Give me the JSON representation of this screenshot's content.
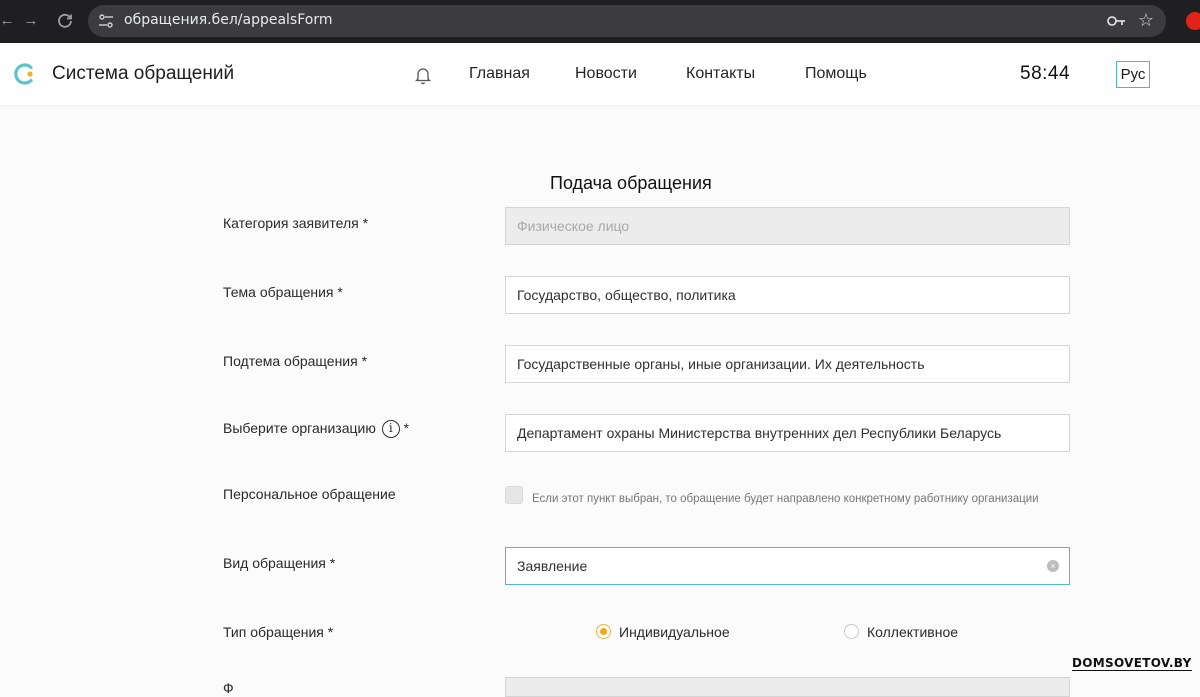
{
  "browser": {
    "url": "обращения.бел/appealsForm",
    "icons": [
      "back-arrow-icon",
      "forward-arrow-icon",
      "reload-icon",
      "site-settings-icon",
      "password-key-icon",
      "bookmark-star-icon",
      "extension-icon"
    ]
  },
  "header": {
    "title": "Система обращений",
    "nav": [
      "Главная",
      "Новости",
      "Контакты",
      "Помощь"
    ],
    "timer": "58:44",
    "language": "Рус"
  },
  "form": {
    "title": "Подача обращения",
    "applicant_category": {
      "label": "Категория заявителя *",
      "placeholder": "Физическое лицо"
    },
    "topic": {
      "label": "Тема обращения *",
      "value": "Государство, общество, политика"
    },
    "subtopic": {
      "label": "Подтема обращения *",
      "value": "Государственные органы, иные организации. Их деятельность"
    },
    "organization": {
      "label": "Выберите организацию",
      "required_mark": "*",
      "info": "i",
      "value": "Департамент охраны Министерства внутренних дел Республики Беларусь"
    },
    "personal": {
      "label": "Персональное обращение",
      "note": "Если этот пункт выбран, то обращение будет направлено конкретному работнику организации",
      "checked": false
    },
    "appeal_kind": {
      "label": "Вид обращения *",
      "value": "Заявление",
      "clear": "×"
    },
    "appeal_type": {
      "label": "Тип обращения *",
      "options": [
        "Индивидуальное",
        "Коллективное"
      ],
      "selected": "Индивидуальное"
    },
    "next_label": "Ф"
  },
  "watermark": "DOMSOVETOV.BY",
  "colors": {
    "accent": "#4fb9c9",
    "radio_selected": "#f0a818",
    "browser_bg": "#1f1f21"
  }
}
